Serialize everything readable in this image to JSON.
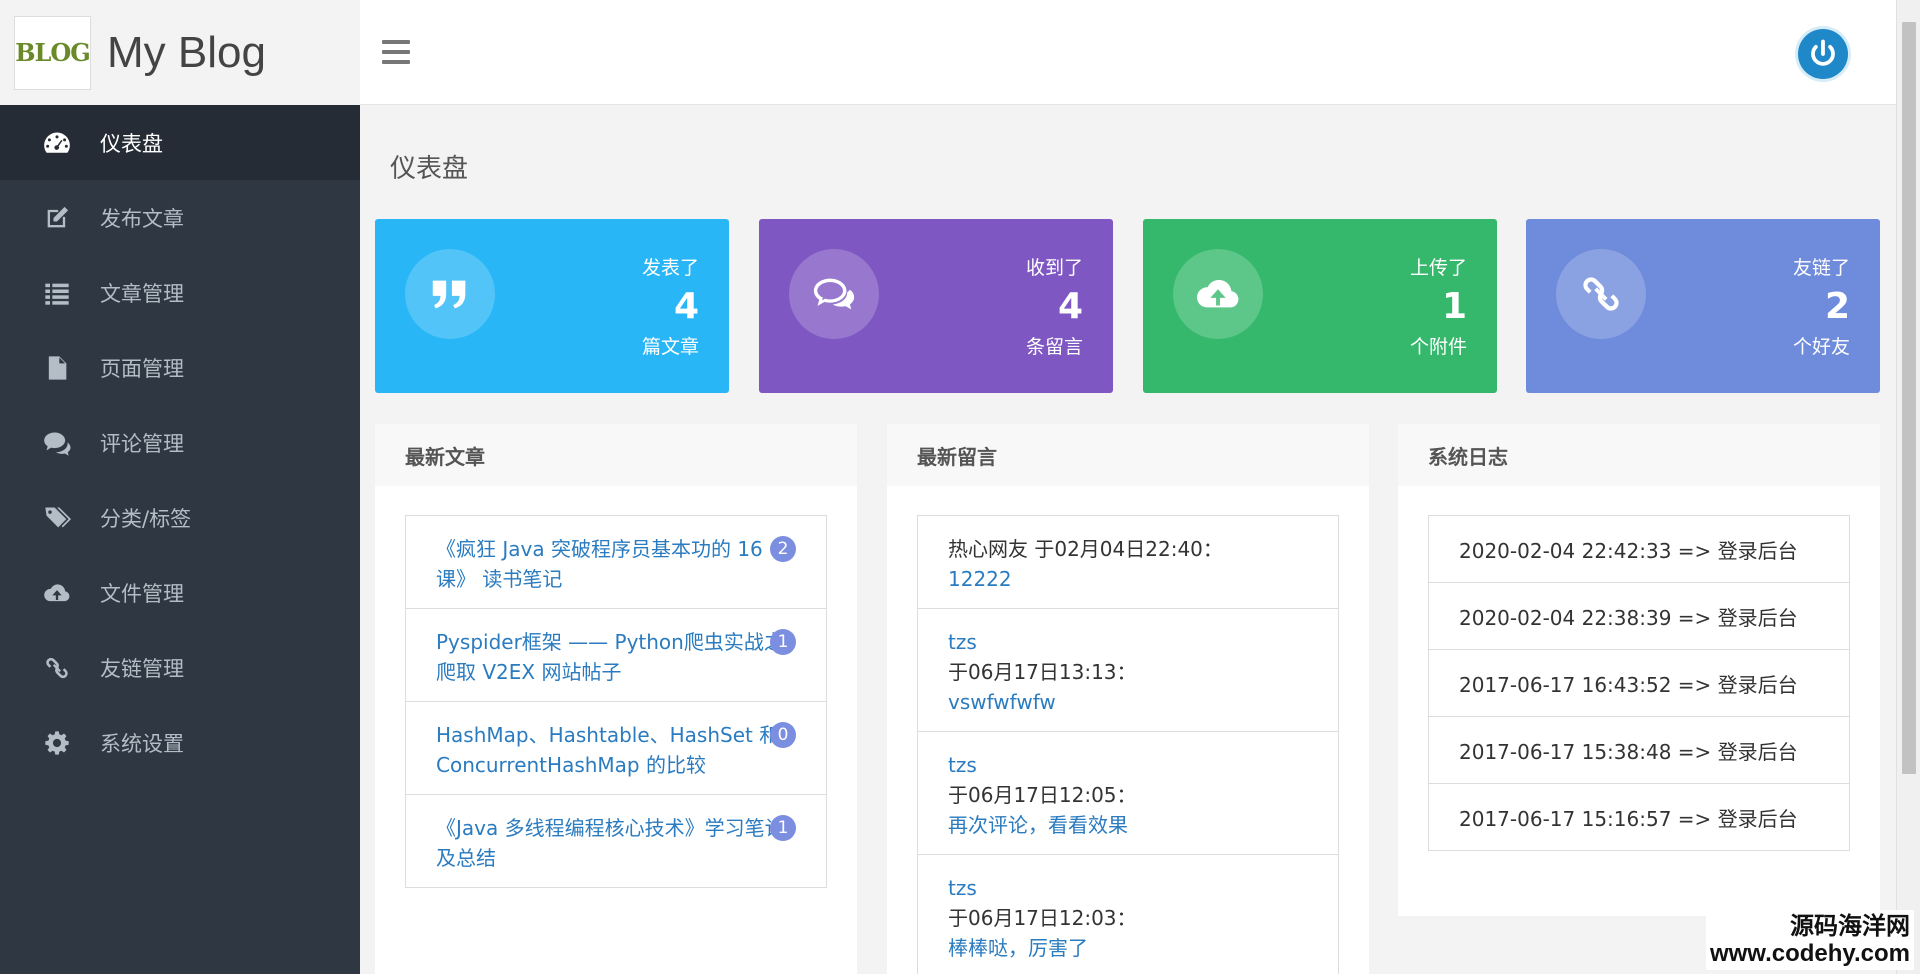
{
  "brand": {
    "logo_text": "BLOG",
    "title": "My Blog"
  },
  "sidebar": {
    "items": [
      {
        "label": "仪表盘",
        "icon": "dashboard-icon"
      },
      {
        "label": "发布文章",
        "icon": "edit-icon"
      },
      {
        "label": "文章管理",
        "icon": "list-icon"
      },
      {
        "label": "页面管理",
        "icon": "file-icon"
      },
      {
        "label": "评论管理",
        "icon": "comments-icon"
      },
      {
        "label": "分类/标签",
        "icon": "tags-icon"
      },
      {
        "label": "文件管理",
        "icon": "cloud-upload-icon"
      },
      {
        "label": "友链管理",
        "icon": "link-icon"
      },
      {
        "label": "系统设置",
        "icon": "gear-icon"
      }
    ]
  },
  "page": {
    "title": "仪表盘"
  },
  "stats": [
    {
      "top": "发表了",
      "value": "4",
      "bottom": "篇文章",
      "color": "#29b6f6",
      "icon": "quote-icon"
    },
    {
      "top": "收到了",
      "value": "4",
      "bottom": "条留言",
      "color": "#7e57c2",
      "icon": "comments-icon"
    },
    {
      "top": "上传了",
      "value": "1",
      "bottom": "个附件",
      "color": "#35b86c",
      "icon": "cloud-upload-icon"
    },
    {
      "top": "友链了",
      "value": "2",
      "bottom": "个好友",
      "color": "#6f8bdb",
      "icon": "link-icon"
    }
  ],
  "panels": {
    "articles": {
      "title": "最新文章",
      "items": [
        {
          "text": "《疯狂 Java 突破程序员基本功的 16 课》 读书笔记",
          "count": "2"
        },
        {
          "text": "Pyspider框架 —— Python爬虫实战之爬取 V2EX 网站帖子",
          "count": "1"
        },
        {
          "text": "HashMap、Hashtable、HashSet 和 ConcurrentHashMap 的比较",
          "count": "0"
        },
        {
          "text": "《Java 多线程编程核心技术》学习笔记及总结",
          "count": "1"
        }
      ]
    },
    "comments": {
      "title": "最新留言",
      "items": [
        {
          "author": "热心网友",
          "time": "于02月04日22:40：",
          "content": "12222"
        },
        {
          "author": "tzs",
          "time": "于06月17日13:13：",
          "content": "vswfwfwfw"
        },
        {
          "author": "tzs",
          "time": "于06月17日12:05：",
          "content": "再次评论，看看效果"
        },
        {
          "author": "tzs",
          "time": "于06月17日12:03：",
          "content": "棒棒哒，厉害了"
        }
      ]
    },
    "logs": {
      "title": "系统日志",
      "items": [
        "2020-02-04 22:42:33 => 登录后台",
        "2020-02-04 22:38:39 => 登录后台",
        "2017-06-17 16:43:52 => 登录后台",
        "2017-06-17 15:38:48 => 登录后台",
        "2017-06-17 15:16:57 => 登录后台"
      ]
    }
  },
  "watermark": {
    "line1": "源码海洋网",
    "line2": "www.codehy.com"
  }
}
